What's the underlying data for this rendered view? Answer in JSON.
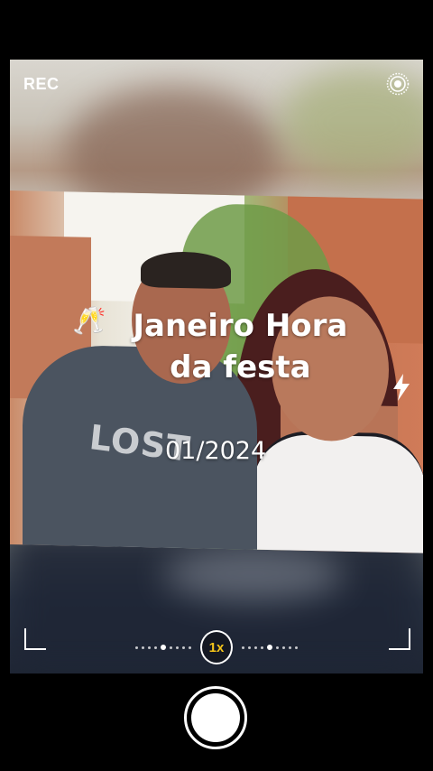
{
  "top_bar": {
    "rec_label": "REC",
    "live_icon": "live-photo-icon"
  },
  "overlay": {
    "emoji": "🥂",
    "title": "Janeiro Hora da festa",
    "date": "01/2024",
    "flash_icon": "flash-icon"
  },
  "photo": {
    "shirt_print": "LOST"
  },
  "zoom": {
    "label": "1x",
    "accent_color": "#f4c419"
  },
  "shutter": {
    "icon": "shutter-button"
  }
}
